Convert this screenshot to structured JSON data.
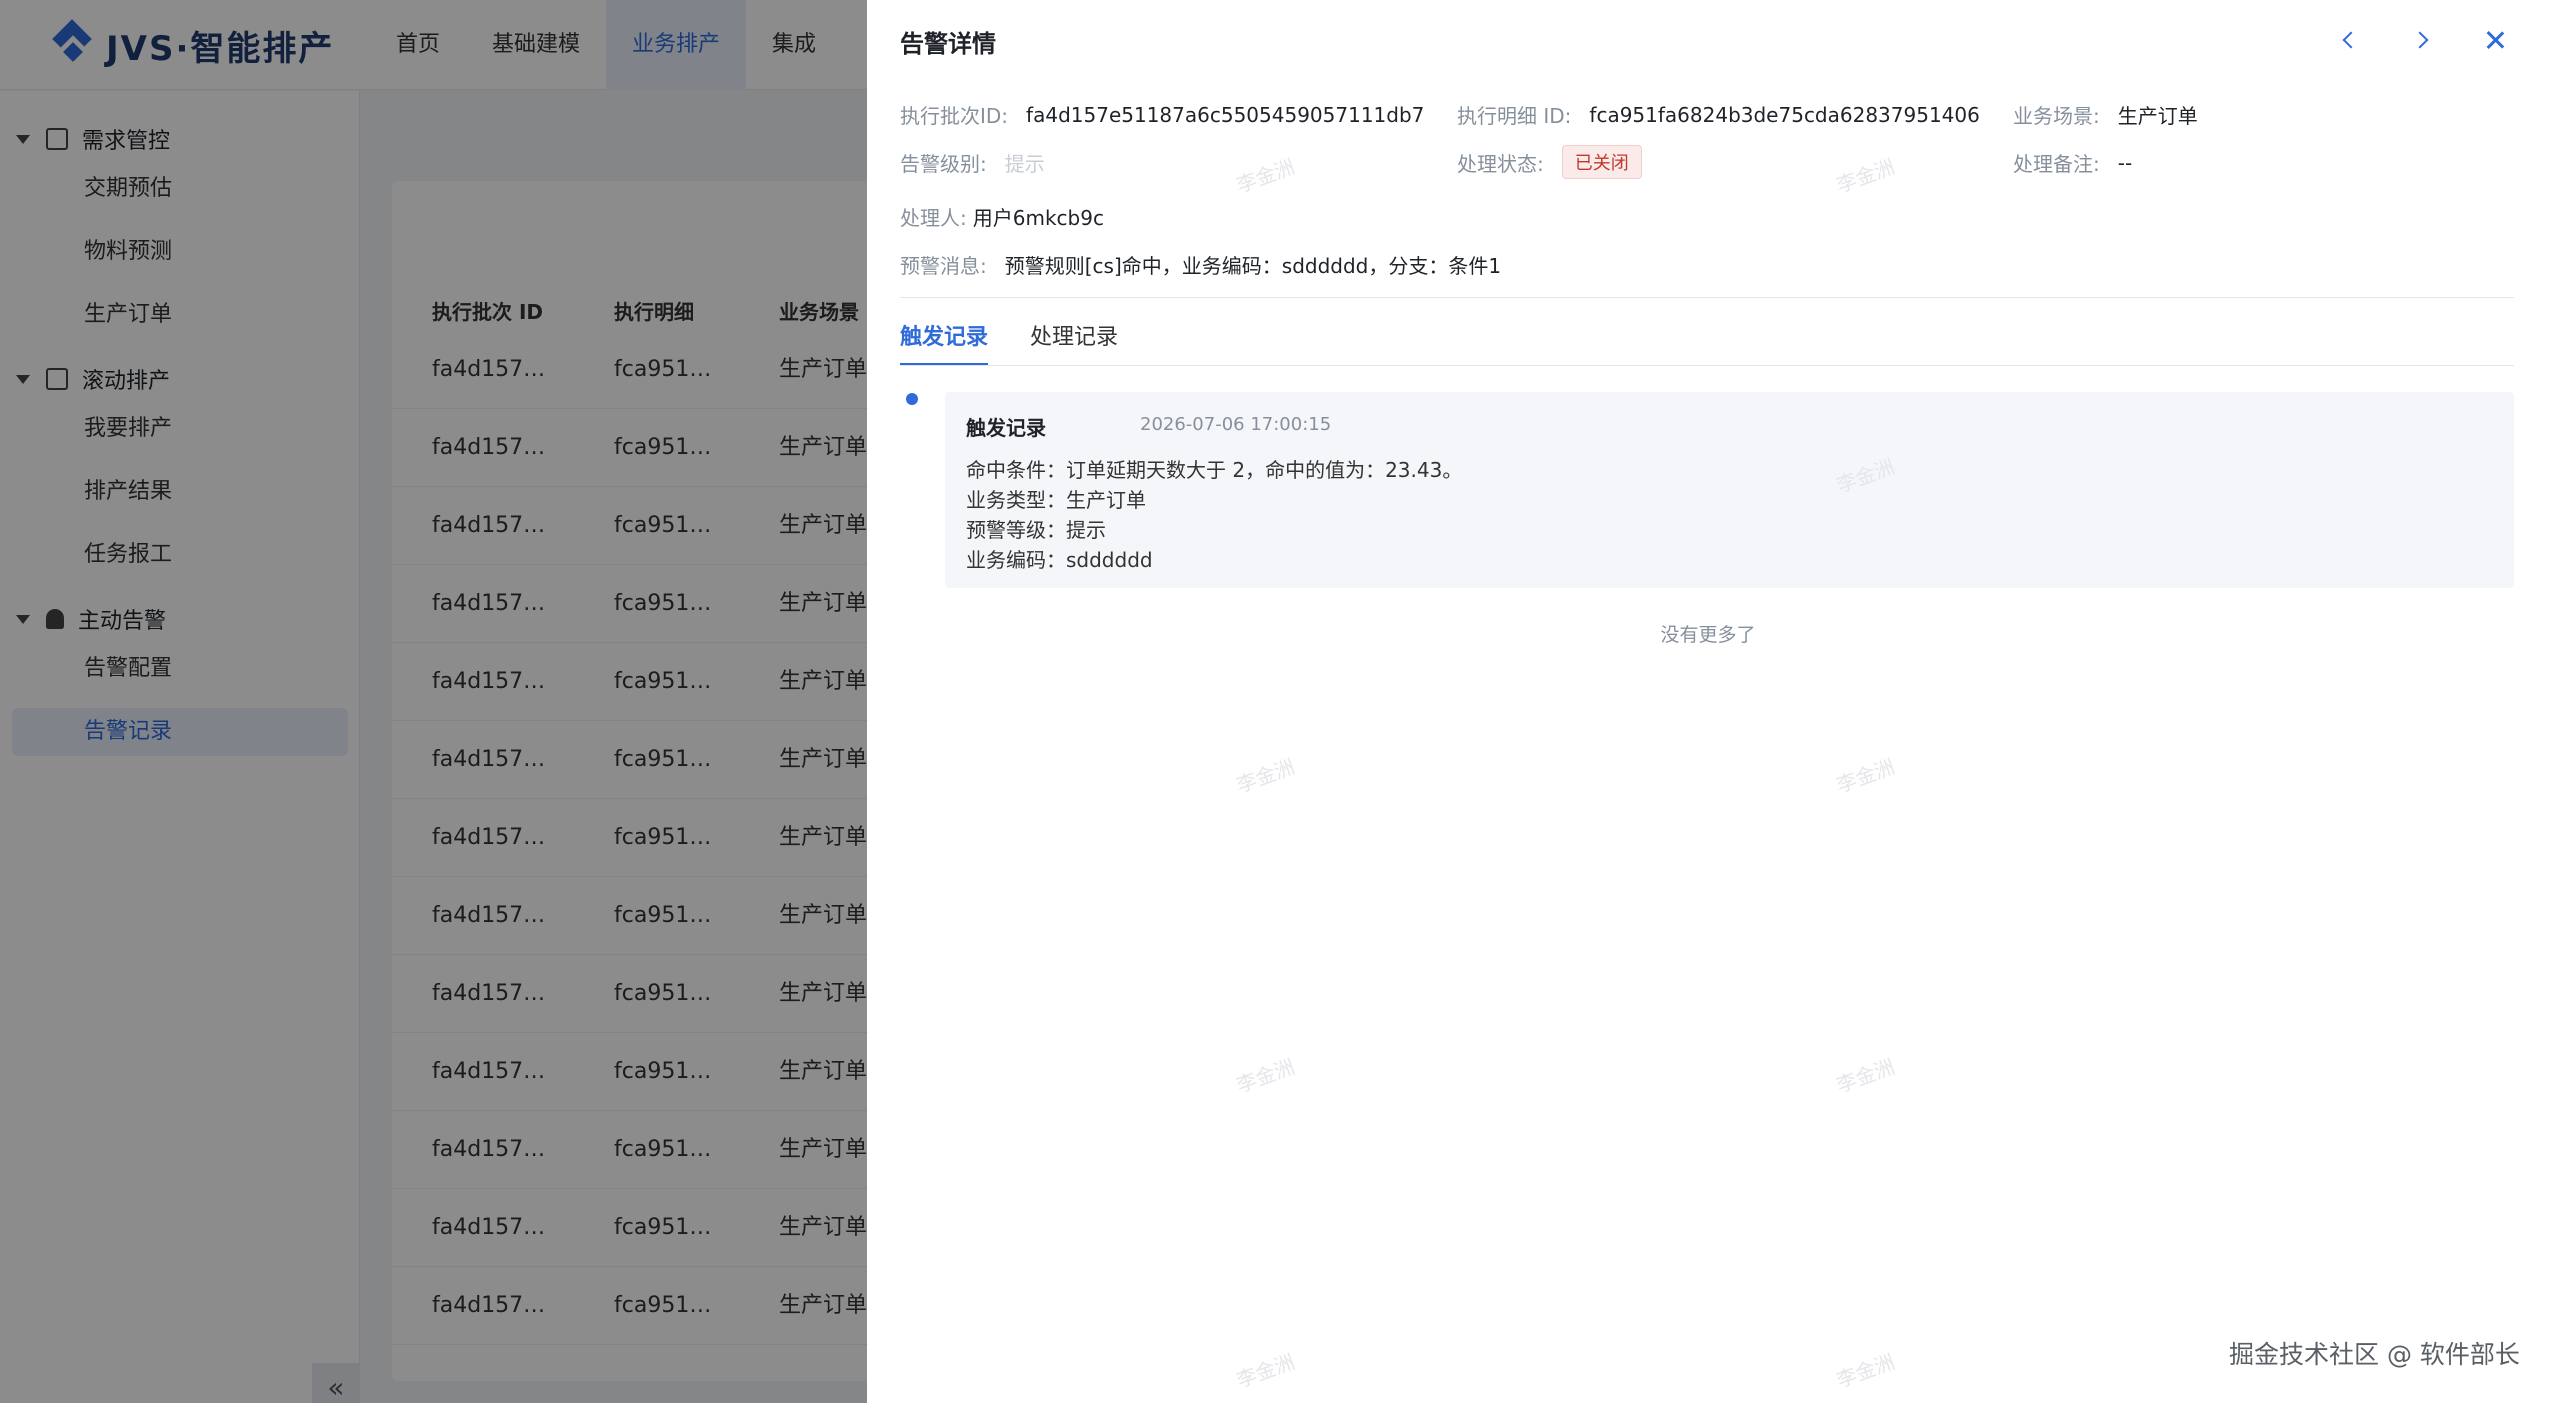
{
  "app": {
    "logo_text": "JVS·智能排产",
    "nav": [
      "首页",
      "基础建模",
      "业务排产",
      "集成"
    ],
    "nav_active_index": 2
  },
  "sidebar": {
    "groups": [
      {
        "label": "需求管控",
        "icon": "calendar-icon",
        "items": [
          "交期预估",
          "物料预测",
          "生产订单"
        ]
      },
      {
        "label": "滚动排产",
        "icon": "building-icon",
        "items": [
          "我要排产",
          "排产结果",
          "任务报工"
        ]
      },
      {
        "label": "主动告警",
        "icon": "bell-icon",
        "items": [
          "告警配置",
          "告警记录"
        ]
      }
    ],
    "active_item": "告警记录",
    "collapse_label": "«"
  },
  "table": {
    "headers": [
      "执行批次 ID",
      "执行明细",
      "业务场景"
    ],
    "rows": [
      [
        "fa4d157…",
        "fca951…",
        "生产订单"
      ],
      [
        "fa4d157…",
        "fca951…",
        "生产订单"
      ],
      [
        "fa4d157…",
        "fca951…",
        "生产订单"
      ],
      [
        "fa4d157…",
        "fca951…",
        "生产订单"
      ],
      [
        "fa4d157…",
        "fca951…",
        "生产订单"
      ],
      [
        "fa4d157…",
        "fca951…",
        "生产订单"
      ],
      [
        "fa4d157…",
        "fca951…",
        "生产订单"
      ],
      [
        "fa4d157…",
        "fca951…",
        "生产订单"
      ],
      [
        "fa4d157…",
        "fca951…",
        "生产订单"
      ],
      [
        "fa4d157…",
        "fca951…",
        "生产订单"
      ],
      [
        "fa4d157…",
        "fca951…",
        "生产订单"
      ],
      [
        "fa4d157…",
        "fca951…",
        "生产订单"
      ],
      [
        "fa4d157…",
        "fca951…",
        "生产订单"
      ]
    ]
  },
  "drawer": {
    "title": "告警详情",
    "fields": {
      "batch_id_label": "执行批次ID:",
      "batch_id": "fa4d157e51187a6c5505459057111db7",
      "detail_id_label": "执行明细 ID:",
      "detail_id": "fca951fa6824b3de75cda62837951406",
      "scene_label": "业务场景:",
      "scene": "生产订单",
      "level_label": "告警级别:",
      "level": "提示",
      "status_label": "处理状态:",
      "status": "已关闭",
      "remark_label": "处理备注:",
      "remark": "--",
      "handler_label": "处理人:",
      "handler": "用户6mkcb9c",
      "message_label": "预警消息:",
      "message": "预警规则[cs]命中，业务编码：sdddddd，分支：条件1"
    },
    "tabs": [
      "触发记录",
      "处理记录"
    ],
    "active_tab": 0,
    "record": {
      "title": "触发记录",
      "time": "2026-07-06 17:00:15",
      "lines": [
        "命中条件：订单延期天数大于 2，命中的值为：23.43。",
        "业务类型：生产订单",
        "预警等级：提示",
        "业务编码：sdddddd"
      ]
    },
    "no_more": "没有更多了"
  },
  "watermark": "李金洲",
  "credit": "掘金技术社区 @ 软件部长"
}
